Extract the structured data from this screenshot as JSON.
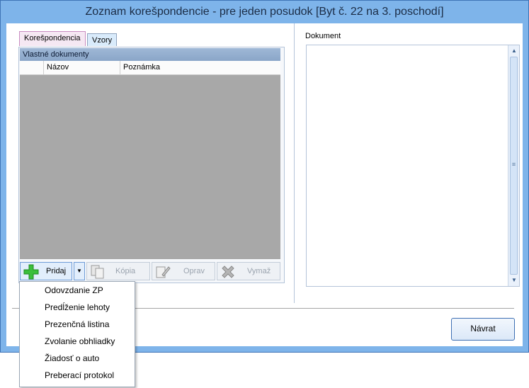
{
  "window": {
    "title": "Zoznam korešpondencie - pre jeden posudok    [Byt č. 22 na 3. poschodí]"
  },
  "tabs": [
    {
      "label": "Korešpondencia",
      "selected": true
    },
    {
      "label": "Vzory",
      "selected": false
    }
  ],
  "panel": {
    "group_title": "Vlastné dokumenty",
    "columns": [
      "",
      "Názov",
      "Poznámka"
    ]
  },
  "toolbar": {
    "add": {
      "label": "Pridaj",
      "icon": "plus-icon"
    },
    "copy": {
      "label": "Kópia",
      "icon": "copy-icon"
    },
    "edit": {
      "label": "Oprav",
      "icon": "edit-icon"
    },
    "delete": {
      "label": "Vymaž",
      "icon": "delete-icon"
    }
  },
  "document": {
    "label": "Dokument"
  },
  "footer": {
    "return_label": "Návrat"
  },
  "dropdown_menu": [
    "Odovzdanie ZP",
    "Predĺženie lehoty",
    "Prezenčná listina",
    "Zvolanie obhliadky",
    "Žiadosť o auto",
    "Preberací protokol"
  ],
  "colors": {
    "title_bar": "#7eb4ea",
    "grid_background": "#a8a8a8",
    "add_icon": "#3cbf3c"
  }
}
